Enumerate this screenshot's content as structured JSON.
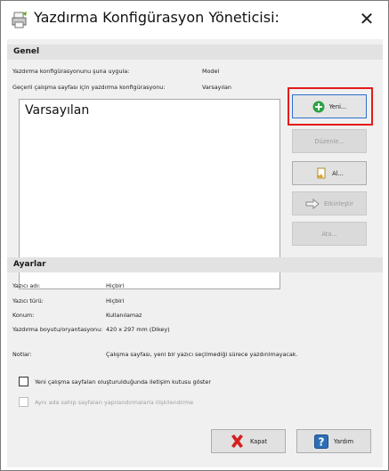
{
  "window": {
    "title": "Yazdırma Konfigürasyon Yöneticisi:",
    "close_glyph": "✕"
  },
  "general": {
    "heading": "Genel",
    "apply_label": "Yazdırma konfigürasyonunu şuna uygula:",
    "apply_value": "Model",
    "current_label": "Geçerli çalışma sayfası için yazdırma konfigürasyonu:",
    "current_value": "Varsayılan",
    "list_items": [
      "Varsayılan"
    ]
  },
  "buttons": {
    "new": "Yeni...",
    "edit": "Düzenle...",
    "import": "Al...",
    "activate": "Etkinleştir",
    "assign": "Ata...",
    "close": "Kapat",
    "help": "Yardım"
  },
  "settings": {
    "heading": "Ayarlar",
    "rows": [
      {
        "label": "Yazıcı adı:",
        "value": "Hiçbiri"
      },
      {
        "label": "Yazıcı türü:",
        "value": "Hiçbiri"
      },
      {
        "label": "Konum:",
        "value": "Kullanılamaz"
      },
      {
        "label": "Yazdırma boyutu/oryantasyonu:",
        "value": "420 x 297 mm (Dikey)"
      }
    ],
    "notes_label": "Notlar:",
    "notes_value": "Çalışma sayfası, yeni bir yazıcı seçilmediği sürece yazdırılmayacak."
  },
  "options": {
    "show_dialog": "Yeni çalışma sayfaları oluşturulduğunda iletişim kutusu göster",
    "link_configs": "Aynı ada sahip sayfaları yapılandırmalarla ilişkilendirme"
  },
  "icons": [
    "printer-app-icon",
    "plus-circle-icon",
    "import-document-icon",
    "arrow-right-icon",
    "red-x-icon",
    "help-question-icon"
  ],
  "colors": {
    "highlight": "#e31b1b",
    "plus_green": "#2ea043",
    "help_blue": "#2d6fb7"
  }
}
